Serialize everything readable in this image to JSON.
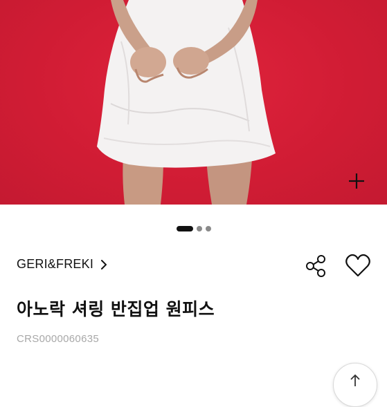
{
  "product": {
    "brand": "GERI&FREKI",
    "title": "아노락 셔링 반집업 원피스",
    "code": "CRS0000060635"
  },
  "gallery": {
    "slide_count": 3,
    "active_index": 0,
    "background_color": "#d01c34"
  },
  "icons": {
    "expand": "plus-icon",
    "brand_chevron": "chevron-right-icon",
    "share": "share-icon",
    "wishlist": "heart-outline-icon",
    "scroll_top": "arrow-up-icon"
  },
  "colors": {
    "text_primary": "#111111",
    "text_muted": "#a8a8a8",
    "indicator_active": "#111111",
    "indicator_inactive": "#8a8a8a"
  }
}
